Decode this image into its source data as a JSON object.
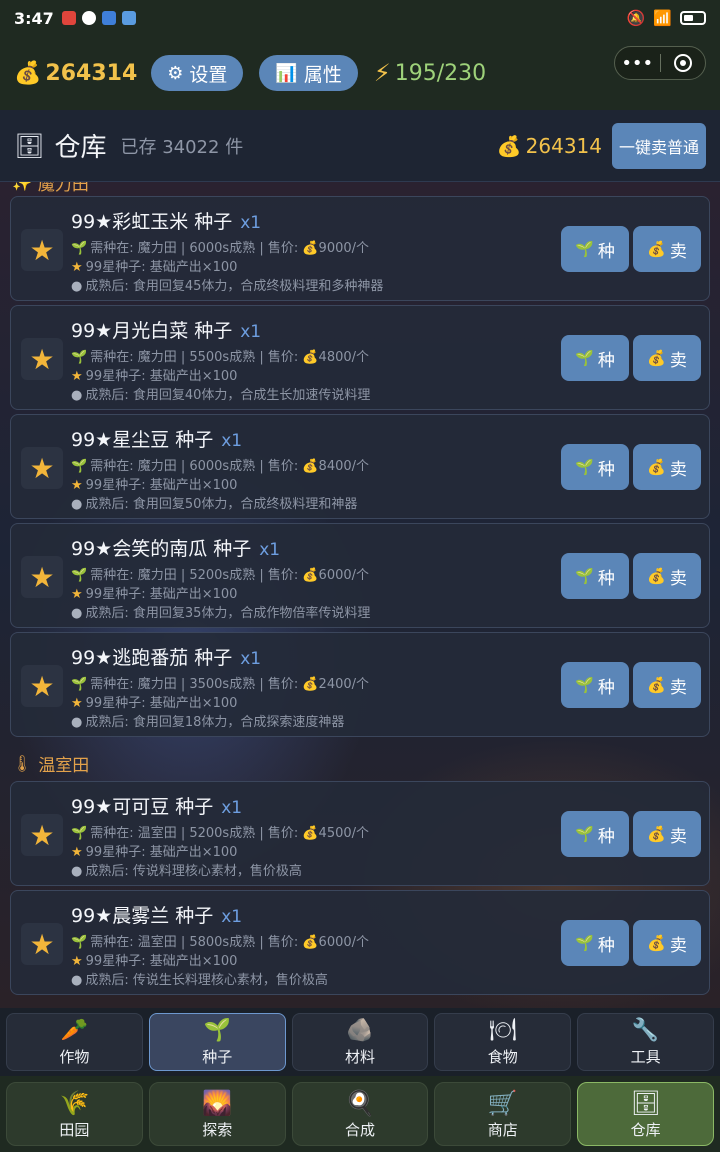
{
  "status_bar": {
    "time": "3:47"
  },
  "header": {
    "gold": "264314",
    "settings_label": "设置",
    "attributes_label": "属性",
    "energy": "195/230"
  },
  "warehouse": {
    "title": "仓库",
    "stored": "已存 34022 件",
    "gold": "264314",
    "sell_all_label": "一键卖普通"
  },
  "categories": {
    "magic_field": "魔力田",
    "greenhouse": "温室田"
  },
  "buttons": {
    "plant": "种",
    "sell": "卖"
  },
  "items": [
    {
      "name": "99★彩虹玉米 种子",
      "qty": "x1",
      "line1": "需种在: 魔力田 | 6000s成熟 | 售价: 💰9000/个",
      "line2": "99星种子: 基础产出×100",
      "line3": "成熟后: 食用回复45体力，合成终极料理和多种神器"
    },
    {
      "name": "99★月光白菜 种子",
      "qty": "x1",
      "line1": "需种在: 魔力田 | 5500s成熟 | 售价: 💰4800/个",
      "line2": "99星种子: 基础产出×100",
      "line3": "成熟后: 食用回复40体力，合成生长加速传说料理"
    },
    {
      "name": "99★星尘豆 种子",
      "qty": "x1",
      "line1": "需种在: 魔力田 | 6000s成熟 | 售价: 💰8400/个",
      "line2": "99星种子: 基础产出×100",
      "line3": "成熟后: 食用回复50体力，合成终极料理和神器"
    },
    {
      "name": "99★会笑的南瓜 种子",
      "qty": "x1",
      "line1": "需种在: 魔力田 | 5200s成熟 | 售价: 💰6000/个",
      "line2": "99星种子: 基础产出×100",
      "line3": "成熟后: 食用回复35体力，合成作物倍率传说料理"
    },
    {
      "name": "99★逃跑番茄 种子",
      "qty": "x1",
      "line1": "需种在: 魔力田 | 3500s成熟 | 售价: 💰2400/个",
      "line2": "99星种子: 基础产出×100",
      "line3": "成熟后: 食用回复18体力，合成探索速度神器"
    },
    {
      "name": "99★可可豆 种子",
      "qty": "x1",
      "line1": "需种在: 温室田 | 5200s成熟 | 售价: 💰4500/个",
      "line2": "99星种子: 基础产出×100",
      "line3": "成熟后: 传说料理核心素材，售价极高"
    },
    {
      "name": "99★晨雾兰 种子",
      "qty": "x1",
      "line1": "需种在: 温室田 | 5800s成熟 | 售价: 💰6000/个",
      "line2": "99星种子: 基础产出×100",
      "line3": "成熟后: 传说生长料理核心素材，售价极高"
    }
  ],
  "category_tabs": [
    {
      "label": "作物",
      "icon": "carrot-icon"
    },
    {
      "label": "种子",
      "icon": "sprout-icon"
    },
    {
      "label": "材料",
      "icon": "ore-icon"
    },
    {
      "label": "食物",
      "icon": "plate-icon"
    },
    {
      "label": "工具",
      "icon": "wrench-icon"
    }
  ],
  "main_nav": [
    {
      "label": "田园",
      "icon": "wheat-icon"
    },
    {
      "label": "探索",
      "icon": "landscape-icon"
    },
    {
      "label": "合成",
      "icon": "frying-pan-icon"
    },
    {
      "label": "商店",
      "icon": "cart-icon"
    },
    {
      "label": "仓库",
      "icon": "cabinet-icon"
    }
  ]
}
